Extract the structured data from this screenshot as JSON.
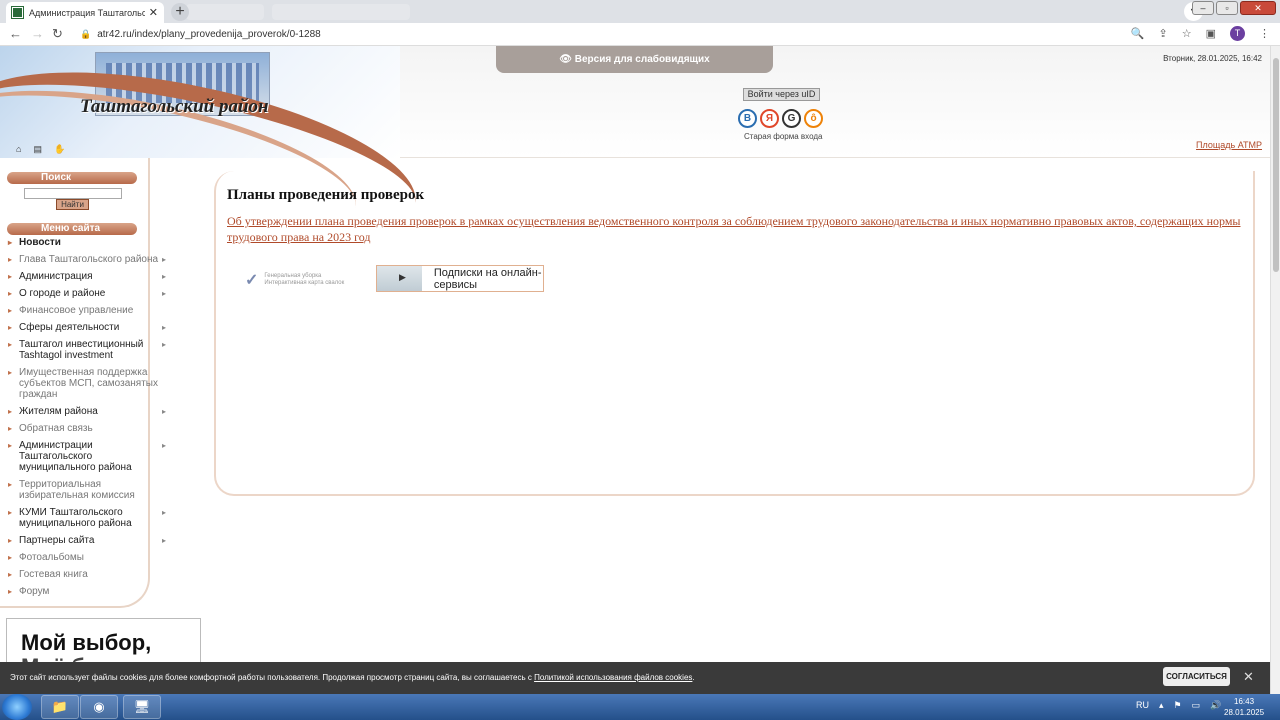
{
  "browser": {
    "tab_title": "Администрация Таштагольского",
    "tab_close": "✕",
    "new_tab": "+",
    "url": "atr42.ru/index/plany_provedenija_proverok/0-1288",
    "back": "←",
    "forward": "→",
    "reload": "↻",
    "profile_initial": "T"
  },
  "header": {
    "site_title": "Таштагольский район",
    "accessibility_label": "👁 Версия для слабовидящих",
    "datetime": "Вторник, 28.01.2025, 16:42",
    "uid_login": "Войти через uID",
    "social": [
      {
        "label": "В",
        "color": "#2a6db0"
      },
      {
        "label": "Я",
        "color": "#e0472a"
      },
      {
        "label": "G",
        "color": "#333333"
      },
      {
        "label": "ô",
        "color": "#ee8208"
      }
    ],
    "old_login": "Старая форма входа",
    "atmr_link": "Площадь АТМР",
    "icons": [
      "home-icon",
      "bookmark-icon",
      "hand-icon"
    ]
  },
  "sidebar": {
    "search_heading": "Поиск",
    "search_button": "Найти",
    "search_value": "",
    "menu_heading": "Меню сайта",
    "items": [
      {
        "label": "Новости",
        "style": "bold",
        "arrow": false
      },
      {
        "label": "Глава Таштагольского района",
        "style": "muted",
        "arrow": true
      },
      {
        "label": "Администрация",
        "style": "normal",
        "arrow": true
      },
      {
        "label": "О городе и районе",
        "style": "normal",
        "arrow": true
      },
      {
        "label": "Финансовое управление",
        "style": "muted",
        "arrow": false
      },
      {
        "label": "Сферы деятельности",
        "style": "normal",
        "arrow": true
      },
      {
        "label": "Таштагол инвестиционный Tashtagol investment",
        "style": "normal",
        "arrow": true
      },
      {
        "label": "Имущественная поддержка субъектов МСП, самозанятых граждан",
        "style": "muted",
        "arrow": false
      },
      {
        "label": "Жителям района",
        "style": "normal",
        "arrow": true
      },
      {
        "label": "Обратная связь",
        "style": "muted",
        "arrow": false
      },
      {
        "label": "Администрации Таштагольского муниципального района",
        "style": "normal",
        "arrow": true
      },
      {
        "label": "Территориальная избирательная комиссия",
        "style": "muted",
        "arrow": false
      },
      {
        "label": "КУМИ Таштагольского муниципального района",
        "style": "normal",
        "arrow": true
      },
      {
        "label": "Партнеры сайта",
        "style": "normal",
        "arrow": true
      },
      {
        "label": "Фотоальбомы",
        "style": "muted",
        "arrow": false
      },
      {
        "label": "Гостевая книга",
        "style": "muted",
        "arrow": false
      },
      {
        "label": "Форум",
        "style": "muted",
        "arrow": false
      }
    ],
    "promo_line1": "Мой выбор,",
    "promo_line2": "Моё буду"
  },
  "main": {
    "page_title": "Планы проведения проверок",
    "doc_link": "Об утверждении плана проведения проверок в рамках осуществления ведомственного контроля за соблюдением трудового законодательства и иных нормативно правовых актов, содержащих нормы трудового права на 2023 год",
    "partner1_title": "Генеральная уборка",
    "partner1_sub": "Интерактивная карта свалок",
    "partner2_text": "Подписки на онлайн-сервисы"
  },
  "cookie": {
    "message": "Этот сайт использует файлы cookies для более комфортной работы пользователя. Продолжая просмотр страниц сайта, вы соглашаетесь с ",
    "policy_link": "Политикой использования файлов cookies",
    "message_end": ".",
    "agree": "СОГЛАСИТЬСЯ",
    "close": "✕"
  },
  "taskbar": {
    "lang": "RU",
    "time": "16:43",
    "date": "28.01.2025"
  }
}
